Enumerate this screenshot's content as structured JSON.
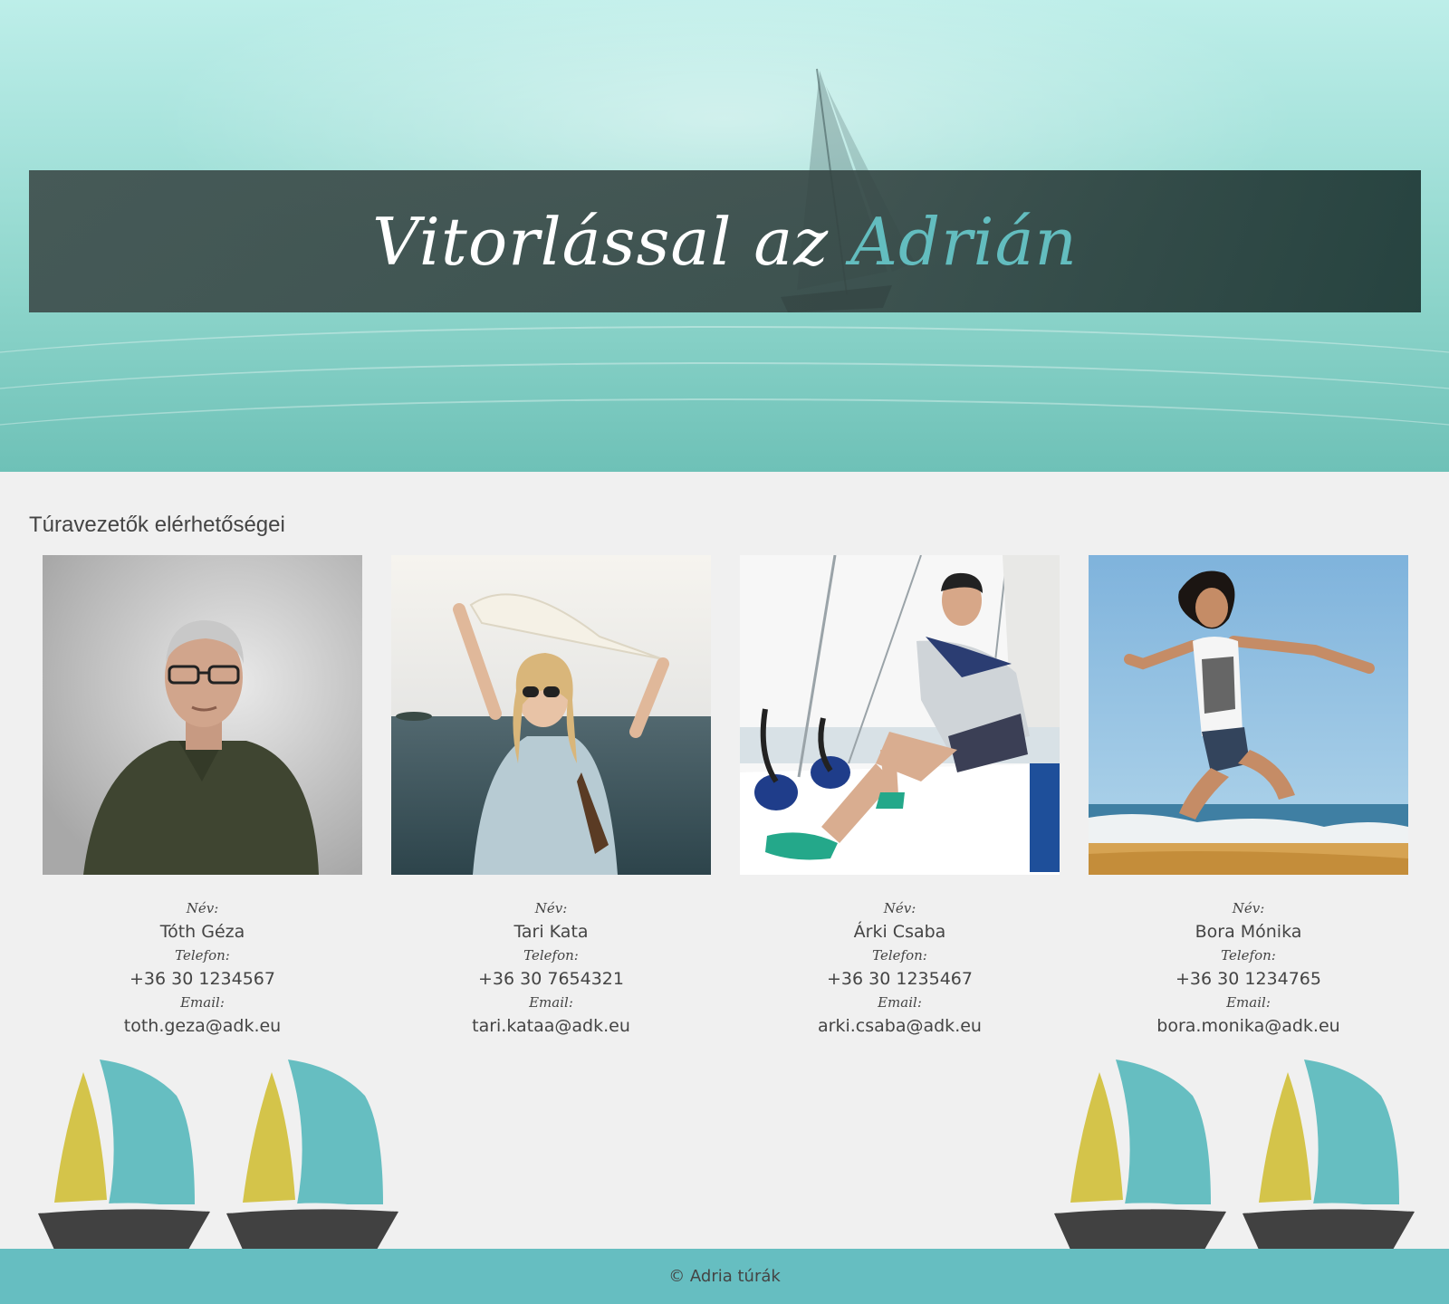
{
  "hero": {
    "title_main": "Vitorlással az ",
    "title_accent": "Adrián"
  },
  "section": {
    "title": "Túraveze­tők elérhetőségei"
  },
  "labels": {
    "name": "Név:",
    "phone": "Telefon:",
    "email": "Email:"
  },
  "guides": [
    {
      "name": "Tóth Géza",
      "phone": "+36 30 1234567",
      "email": "toth.geza@adk.eu"
    },
    {
      "name": "Tari Kata",
      "phone": "+36 30 7654321",
      "email": "tari.kataa@adk.eu"
    },
    {
      "name": "Árki Csaba",
      "phone": "+36 30 1235467",
      "email": "arki.csaba@adk.eu"
    },
    {
      "name": "Bora Mónika",
      "phone": "+36 30 1234765",
      "email": "bora.monika@adk.eu"
    }
  ],
  "footer": {
    "text": "© Adria túrák"
  },
  "colors": {
    "accent": "#63bdbf",
    "footer": "#66bec1",
    "sail_yellow": "#d4c44a",
    "sail_teal": "#66bec1",
    "hull": "#414141"
  }
}
